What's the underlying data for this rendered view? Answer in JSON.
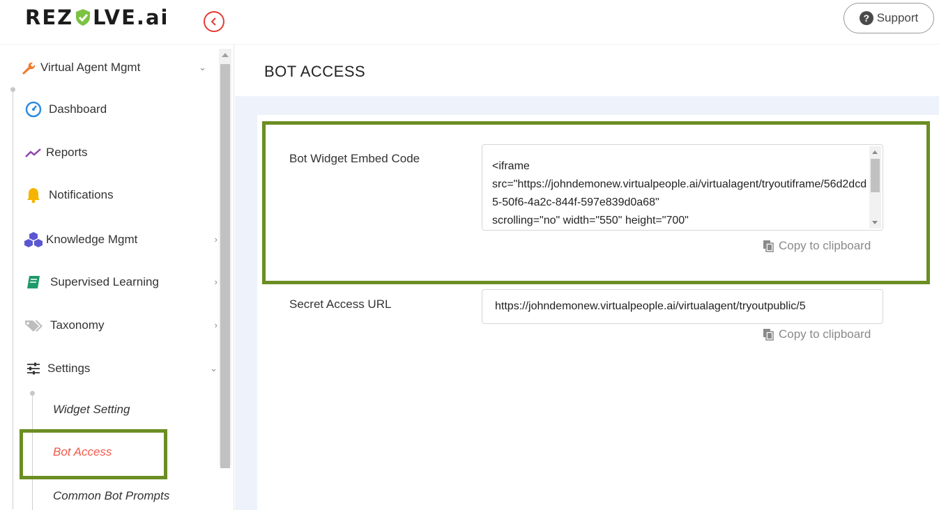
{
  "brand": {
    "logo_text_left": "REZ",
    "logo_text_right": "LVE",
    "logo_text_suffix": ".ai",
    "accent_color": "#e53935"
  },
  "header": {
    "support_label": "Support",
    "support_icon": "question-circle-icon"
  },
  "sidebar": {
    "items": [
      {
        "label": "Virtual Agent Mgmt",
        "icon": "wrench-icon",
        "chevron": "down"
      },
      {
        "label": "Dashboard",
        "icon": "speedometer-icon"
      },
      {
        "label": "Reports",
        "icon": "trend-line-icon"
      },
      {
        "label": "Notifications",
        "icon": "bell-icon"
      },
      {
        "label": "Knowledge Mgmt",
        "icon": "cubes-icon",
        "chevron": "right"
      },
      {
        "label": "Supervised Learning",
        "icon": "book-icon",
        "chevron": "right"
      },
      {
        "label": "Taxonomy",
        "icon": "tags-icon",
        "chevron": "right"
      },
      {
        "label": "Settings",
        "icon": "sliders-icon",
        "chevron": "down"
      }
    ],
    "sub_items": [
      {
        "label": "Widget Setting",
        "active": false
      },
      {
        "label": "Bot Access",
        "active": true
      },
      {
        "label": "Common Bot Prompts",
        "active": false
      }
    ]
  },
  "page": {
    "title": "BOT ACCESS"
  },
  "form": {
    "embed_label": "Bot Widget Embed Code",
    "embed_code": "<iframe\nsrc=\"https://johndemonew.virtualpeople.ai/virtualagent/tryoutiframe/56d2dcd5-50f6-4a2c-844f-597e839d0a68\"\nscrolling=\"no\" width=\"550\" height=\"700\"",
    "secret_label": "Secret Access URL",
    "secret_url": "https://johndemonew.virtualpeople.ai/virtualagent/tryoutpublic/5",
    "copy_label": "Copy to clipboard",
    "copy_icon": "clipboard-icon"
  },
  "colors": {
    "highlight": "#6b8e23",
    "active_sub_item": "#ef5b4c"
  }
}
